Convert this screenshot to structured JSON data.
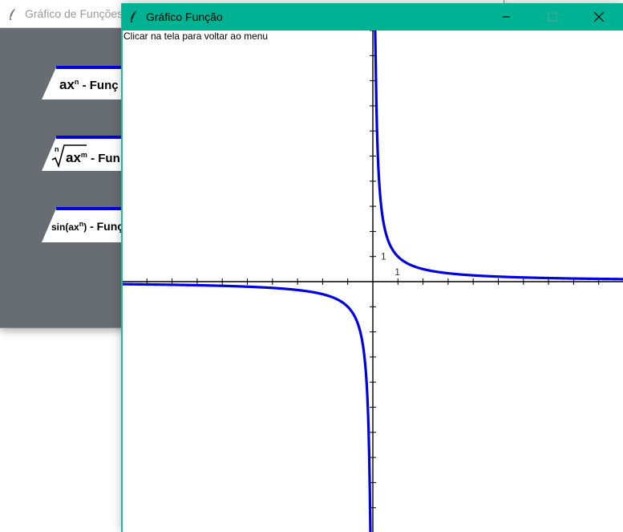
{
  "menu_window": {
    "title": "Gráfico de Funções",
    "buttons": [
      {
        "prefix": "ax",
        "sup": "n",
        "suffix": " - Funç"
      },
      {
        "root_index": "n",
        "radicand": "ax",
        "radicand_sup": "m",
        "suffix": " - Fun"
      },
      {
        "prefix": "sin(ax",
        "sup": "n",
        "close": ")",
        "suffix": " - Funç"
      }
    ]
  },
  "graph_window": {
    "title": "Gráfico Função",
    "hint": "Clicar na tela para voltar ao menu",
    "controls": {
      "minimize": "minimize",
      "maximize": "maximize",
      "close": "close"
    }
  },
  "chart_data": {
    "type": "line",
    "title": "",
    "xlabel": "",
    "ylabel": "",
    "xlim": [
      -10,
      10
    ],
    "ylim": [
      -10,
      10
    ],
    "grid": false,
    "tick_step": 1,
    "tick_labels": {
      "x": "1",
      "y": "1"
    },
    "series": [
      {
        "function": "1/x",
        "color": "#0000e0"
      }
    ]
  }
}
